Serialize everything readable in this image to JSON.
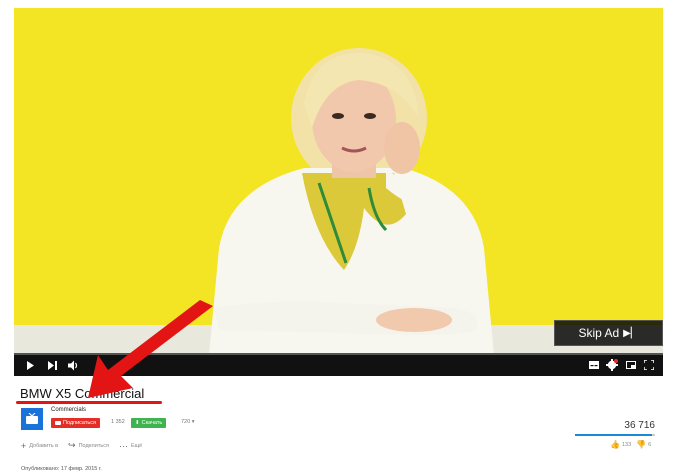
{
  "player": {
    "skip_ad_label": "Skip Ad",
    "progress_fraction": 0.0
  },
  "video": {
    "title": "BMW X5 Commercial"
  },
  "channel": {
    "name": "Commercials",
    "subscribe_label": "Подписаться",
    "subscriber_count": "1 352",
    "download_label": "Скачать",
    "quality": "720"
  },
  "stats": {
    "views": "36 716",
    "likes": "133",
    "dislikes": "6",
    "like_ratio": 0.96
  },
  "actions": {
    "add_label": "Добавить в",
    "share_label": "Поделиться",
    "more_label": "Ещё"
  },
  "published": "Опубликовано: 17 февр. 2015 г.",
  "colors": {
    "video_bg": "#f3e424",
    "subscribe": "#e52d27",
    "download": "#3fb34f",
    "annotation": "#e21414"
  },
  "icons": {
    "play": "play-icon",
    "next": "next-icon",
    "volume": "volume-icon",
    "captions": "captions-icon",
    "settings": "settings-icon",
    "miniplayer": "miniplayer-icon",
    "fullscreen": "fullscreen-icon"
  }
}
